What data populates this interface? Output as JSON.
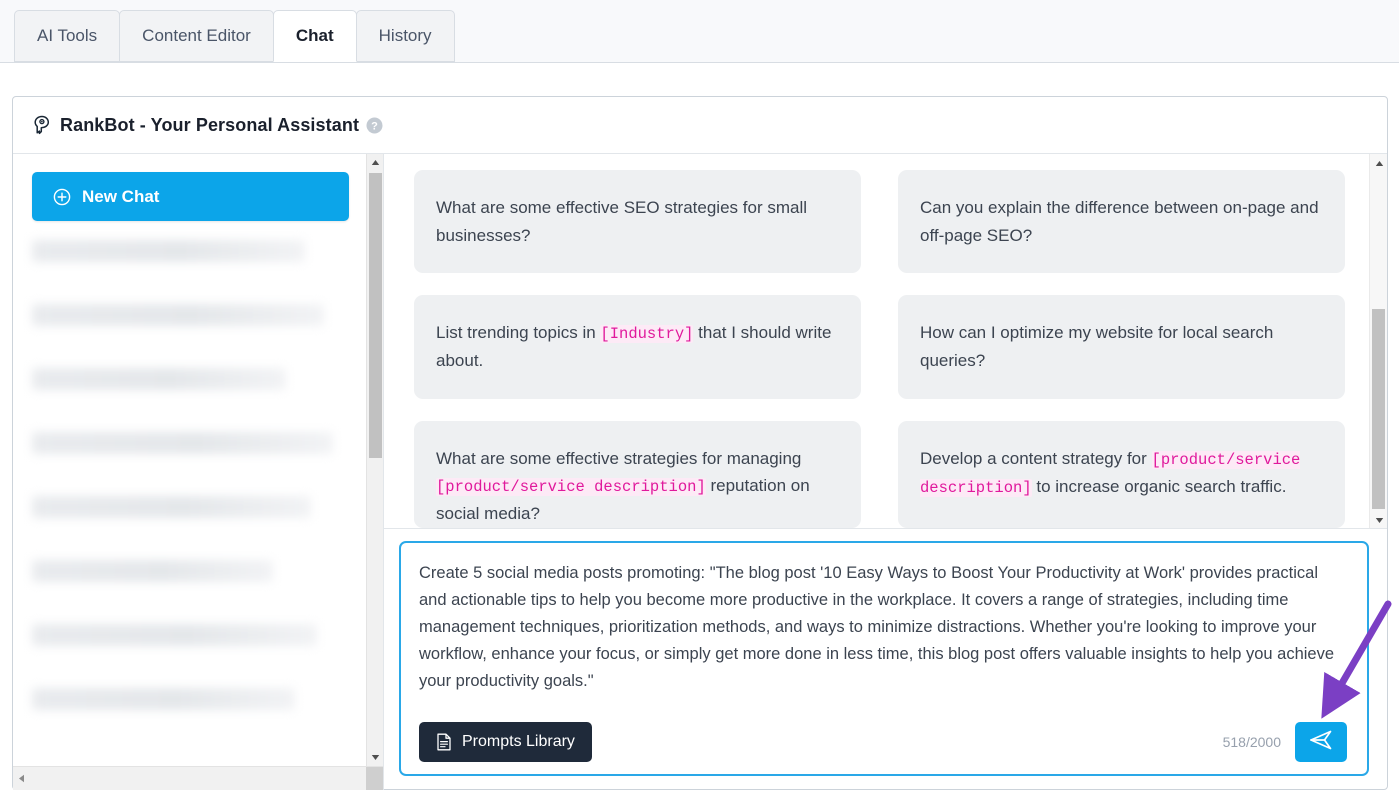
{
  "tabs": [
    {
      "label": "AI Tools",
      "active": false
    },
    {
      "label": "Content Editor",
      "active": false
    },
    {
      "label": "Chat",
      "active": true
    },
    {
      "label": "History",
      "active": false
    }
  ],
  "panel": {
    "title": "RankBot - Your Personal Assistant",
    "bot_icon": "robot-head-icon",
    "help_icon": "help-circle-icon"
  },
  "sidebar": {
    "new_chat_label": "New Chat",
    "new_chat_icon": "plus-circle-icon",
    "history_placeholder_count": 8
  },
  "prompts": [
    {
      "parts": [
        {
          "t": "What are some effective SEO strategies for small businesses?",
          "ph": false
        }
      ]
    },
    {
      "parts": [
        {
          "t": "Can you explain the difference between on-page and off-page SEO?",
          "ph": false
        }
      ]
    },
    {
      "parts": [
        {
          "t": "List trending topics in ",
          "ph": false
        },
        {
          "t": "[Industry]",
          "ph": true
        },
        {
          "t": " that I should write about.",
          "ph": false
        }
      ]
    },
    {
      "parts": [
        {
          "t": "How can I optimize my website for local search queries?",
          "ph": false
        }
      ]
    },
    {
      "parts": [
        {
          "t": "What are some effective strategies for managing ",
          "ph": false
        },
        {
          "t": "[product/service description]",
          "ph": true
        },
        {
          "t": " reputation on social media?",
          "ph": false
        }
      ]
    },
    {
      "parts": [
        {
          "t": "Develop a content strategy for ",
          "ph": false
        },
        {
          "t": "[product/service description]",
          "ph": true
        },
        {
          "t": " to increase organic search traffic.",
          "ph": false
        }
      ]
    }
  ],
  "composer": {
    "value": "Create 5 social media posts promoting: \"The blog post '10 Easy Ways to Boost Your Productivity at Work' provides practical and actionable tips to help you become more productive in the workplace. It covers a range of strategies, including time management techniques, prioritization methods, and ways to minimize distractions. Whether you're looking to improve your workflow, enhance your focus, or simply get more done in less time, this blog post offers valuable insights to help you achieve your productivity goals.\"",
    "prompts_library_label": "Prompts Library",
    "prompts_library_icon": "document-icon",
    "counter": "518/2000",
    "send_icon": "paper-plane-icon"
  },
  "colors": {
    "accent": "#0ca5e9",
    "placeholder_text": "#e0199c",
    "placeholder_bg": "#fdeaf6",
    "dark_button": "#1f2a3a",
    "annotation_arrow": "#7b3fc4",
    "card_bg": "#eef0f2"
  },
  "annotation": {
    "arrow": "purple-arrow-pointing-to-send-button"
  }
}
